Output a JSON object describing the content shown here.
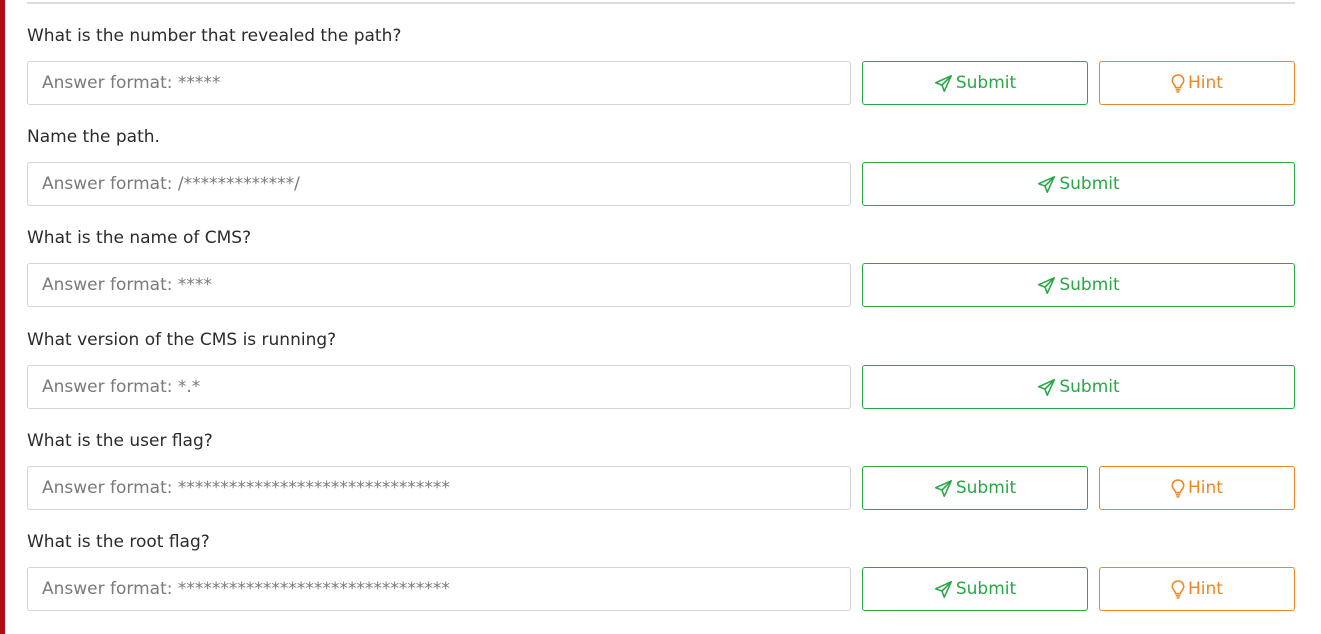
{
  "colors": {
    "accent_bar": "#b30c17",
    "submit": "#28a745",
    "hint": "#f08522"
  },
  "submit_label": "Submit",
  "hint_label": "Hint",
  "icons": {
    "submit": "paper-plane-icon",
    "hint": "lightbulb-icon"
  },
  "questions": [
    {
      "label": "What is the number that revealed the path?",
      "placeholder": "Answer format: *****",
      "value": "",
      "has_hint": true
    },
    {
      "label": "Name the path.",
      "placeholder": "Answer format: /*************/",
      "value": "",
      "has_hint": false
    },
    {
      "label": "What is the name of CMS?",
      "placeholder": "Answer format: ****",
      "value": "",
      "has_hint": false
    },
    {
      "label": "What version of the CMS is running?",
      "placeholder": "Answer format: *.*",
      "value": "",
      "has_hint": false
    },
    {
      "label": "What is the user flag?",
      "placeholder": "Answer format: ********************************",
      "value": "",
      "has_hint": true
    },
    {
      "label": "What is the root flag?",
      "placeholder": "Answer format: ********************************",
      "value": "",
      "has_hint": true
    }
  ]
}
